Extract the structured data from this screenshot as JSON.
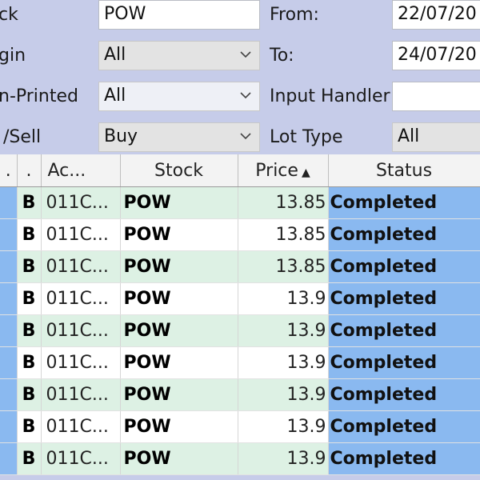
{
  "filters": {
    "stock_label": "ck",
    "stock_value": "POW",
    "origin_label": "gin",
    "origin_value": "All",
    "printed_label": "n-Printed",
    "printed_value": "All",
    "buysell_label": "/Sell",
    "buysell_value": "Buy",
    "from_label": "From:",
    "from_value": "22/07/20",
    "to_label": "To:",
    "to_value": "24/07/20",
    "input_handler_label": "Input Handler",
    "input_handler_value": "",
    "lot_type_label": "Lot Type",
    "lot_type_value": "All"
  },
  "table": {
    "headers": [
      ".",
      ".",
      "Ac...",
      "Stock",
      "Price",
      "Status"
    ],
    "sort_indicator": "▲",
    "rows": [
      {
        "side": "B",
        "account": "011C...",
        "stock": "POW",
        "price": "13.85",
        "status": "Completed"
      },
      {
        "side": "B",
        "account": "011C...",
        "stock": "POW",
        "price": "13.85",
        "status": "Completed"
      },
      {
        "side": "B",
        "account": "011C...",
        "stock": "POW",
        "price": "13.85",
        "status": "Completed"
      },
      {
        "side": "B",
        "account": "011C...",
        "stock": "POW",
        "price": "13.9",
        "status": "Completed"
      },
      {
        "side": "B",
        "account": "011C...",
        "stock": "POW",
        "price": "13.9",
        "status": "Completed"
      },
      {
        "side": "B",
        "account": "011C...",
        "stock": "POW",
        "price": "13.9",
        "status": "Completed"
      },
      {
        "side": "B",
        "account": "011C...",
        "stock": "POW",
        "price": "13.9",
        "status": "Completed"
      },
      {
        "side": "B",
        "account": "011C...",
        "stock": "POW",
        "price": "13.9",
        "status": "Completed"
      },
      {
        "side": "B",
        "account": "011C...",
        "stock": "POW",
        "price": "13.9",
        "status": "Completed"
      }
    ]
  },
  "colors": {
    "form_bg": "#c6cce9",
    "selected_cell": "#8ab9f0",
    "alt_row_green": "#ddf1e4"
  },
  "icons": {
    "combo_arrow": "chevron-down-icon",
    "sort": "sort-ascending-icon"
  }
}
